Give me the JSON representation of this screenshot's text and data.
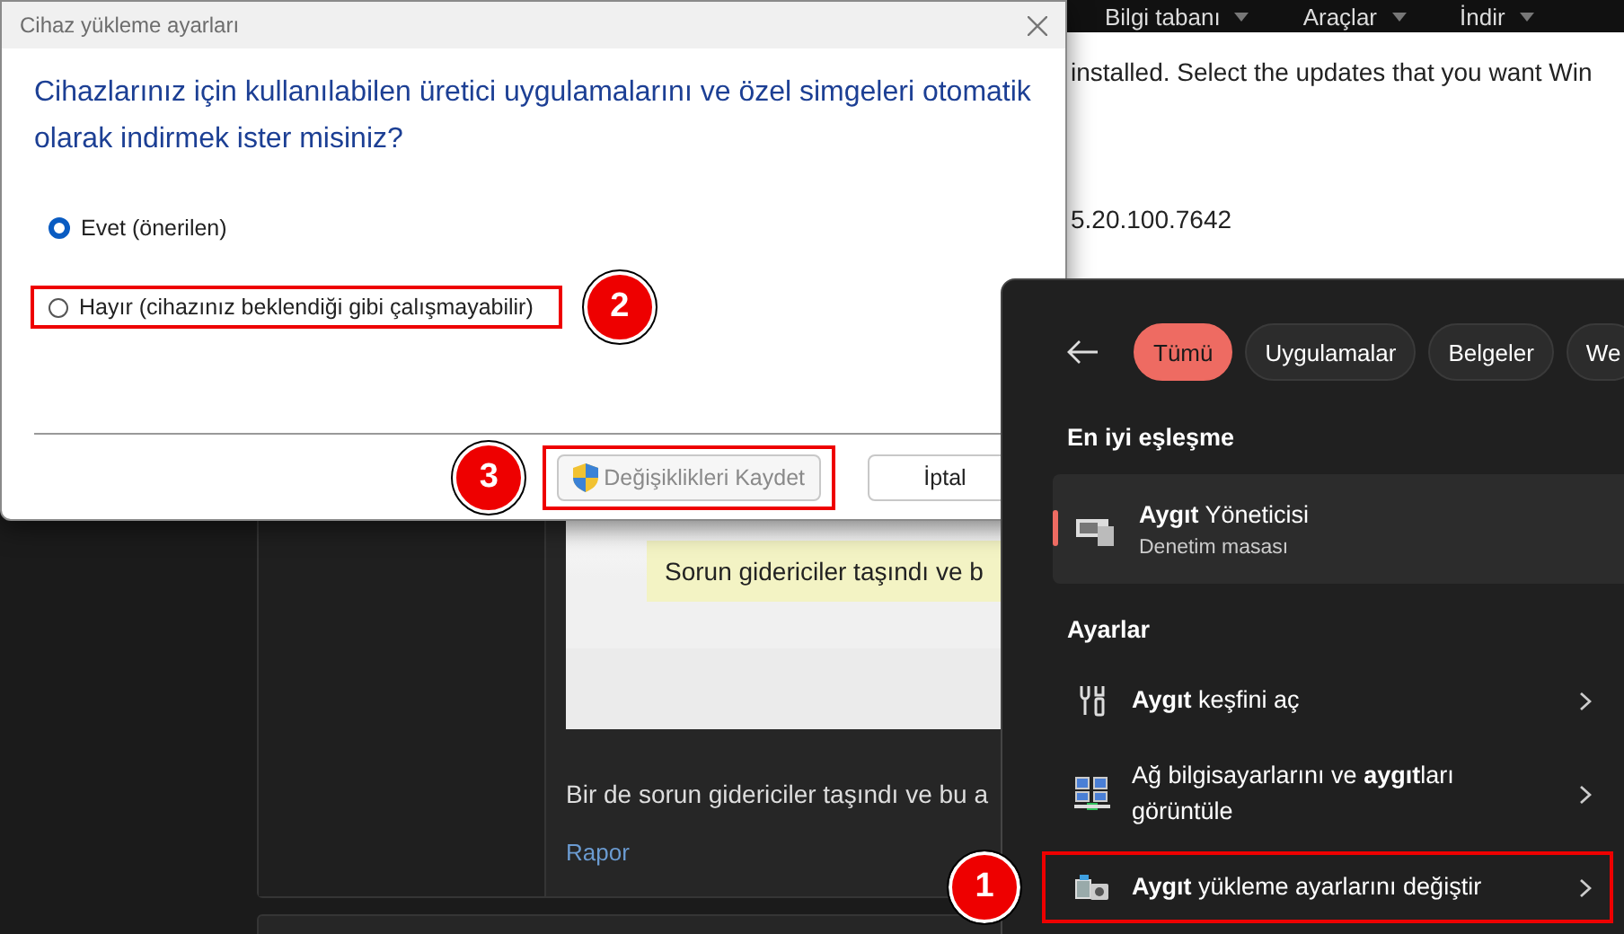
{
  "background_page": {
    "nav": [
      {
        "label": "Bilgi tabanı"
      },
      {
        "label": "Araçlar"
      },
      {
        "label": "İndir"
      }
    ],
    "lines": [
      "installed. Select the updates that you want Win",
      "5.20.100.7642"
    ],
    "post": {
      "embedded_note": "Sorun gidericiler taşındı ve b",
      "text": "Bir de sorun gidericiler taşındı ve bu a",
      "link": "Rapor"
    }
  },
  "dialog": {
    "title": "Cihaz yükleme ayarları",
    "question": "Cihazlarınız için kullanılabilen üretici uygulamalarını ve özel simgeleri otomatik olarak indirmek ister misiniz?",
    "options": [
      {
        "label": "Evet (önerilen)",
        "selected": true,
        "highlighted": false
      },
      {
        "label": "Hayır (cihazınız beklendiği gibi çalışmayabilir)",
        "selected": false,
        "highlighted": true,
        "callout": "2"
      }
    ],
    "buttons": [
      {
        "label": "Değişiklikleri Kaydet",
        "kind": "shield",
        "disabled": true,
        "highlighted": true,
        "callout": "3"
      },
      {
        "label": "İptal",
        "kind": "plain",
        "disabled": false,
        "highlighted": false
      }
    ]
  },
  "search_panel": {
    "tabs": [
      {
        "label": "Tümü",
        "selected": true
      },
      {
        "label": "Uygulamalar",
        "selected": false
      },
      {
        "label": "Belgeler",
        "selected": false
      },
      {
        "label": "We",
        "selected": false
      }
    ],
    "best_match_heading": "En iyi eşleşme",
    "best_match": {
      "title": "**Aygıt** Yöneticisi",
      "subtitle": "Denetim masası"
    },
    "settings_heading": "Ayarlar",
    "settings": [
      {
        "label": "**Aygıt** keşfini aç",
        "kind": "tools",
        "highlighted": false
      },
      {
        "label": "Ağ bilgisayarlarını ve **aygıt**ları görüntüle",
        "kind": "network",
        "highlighted": false
      },
      {
        "label": "**Aygıt** yükleme ayarlarını değiştir",
        "kind": "device",
        "highlighted": true,
        "callout": "1"
      }
    ]
  }
}
